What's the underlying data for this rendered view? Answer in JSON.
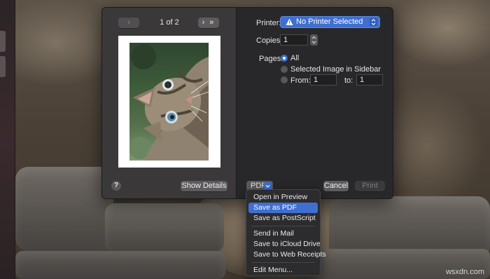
{
  "print_dialog": {
    "preview": {
      "prev_label": "‹",
      "page_count": "1 of 2",
      "next_label": "› »"
    },
    "help_label": "?",
    "show_details_label": "Show Details",
    "printer": {
      "label": "Printer:",
      "value": "No Printer Selected",
      "icon": "warning-icon"
    },
    "copies": {
      "label": "Copies:",
      "value": "1"
    },
    "pages": {
      "label": "Pages:",
      "options": [
        {
          "label": "All",
          "selected": true
        },
        {
          "label": "Selected Image in Sidebar",
          "selected": false
        },
        {
          "label": "From:",
          "selected": false
        }
      ],
      "from_value": "1",
      "to_label": "to:",
      "to_value": "1"
    },
    "pdf_label": "PDF",
    "cancel_label": "Cancel",
    "print_label": "Print"
  },
  "pdf_menu": {
    "items": [
      {
        "label": "Open in Preview",
        "active": false
      },
      {
        "label": "Save as PDF",
        "active": true
      },
      {
        "label": "Save as PostScript",
        "active": false
      },
      {
        "label": "Send in Mail",
        "active": false
      },
      {
        "label": "Save to iCloud Drive",
        "active": false
      },
      {
        "label": "Save to Web Receipts",
        "active": false
      },
      {
        "label": "Edit Menu...",
        "active": false
      }
    ]
  },
  "watermark": "wsxdn.com",
  "colors": {
    "accent": "#3f6fd0",
    "sheet_bg": "#28282a",
    "preview_bg": "#3a3838"
  }
}
